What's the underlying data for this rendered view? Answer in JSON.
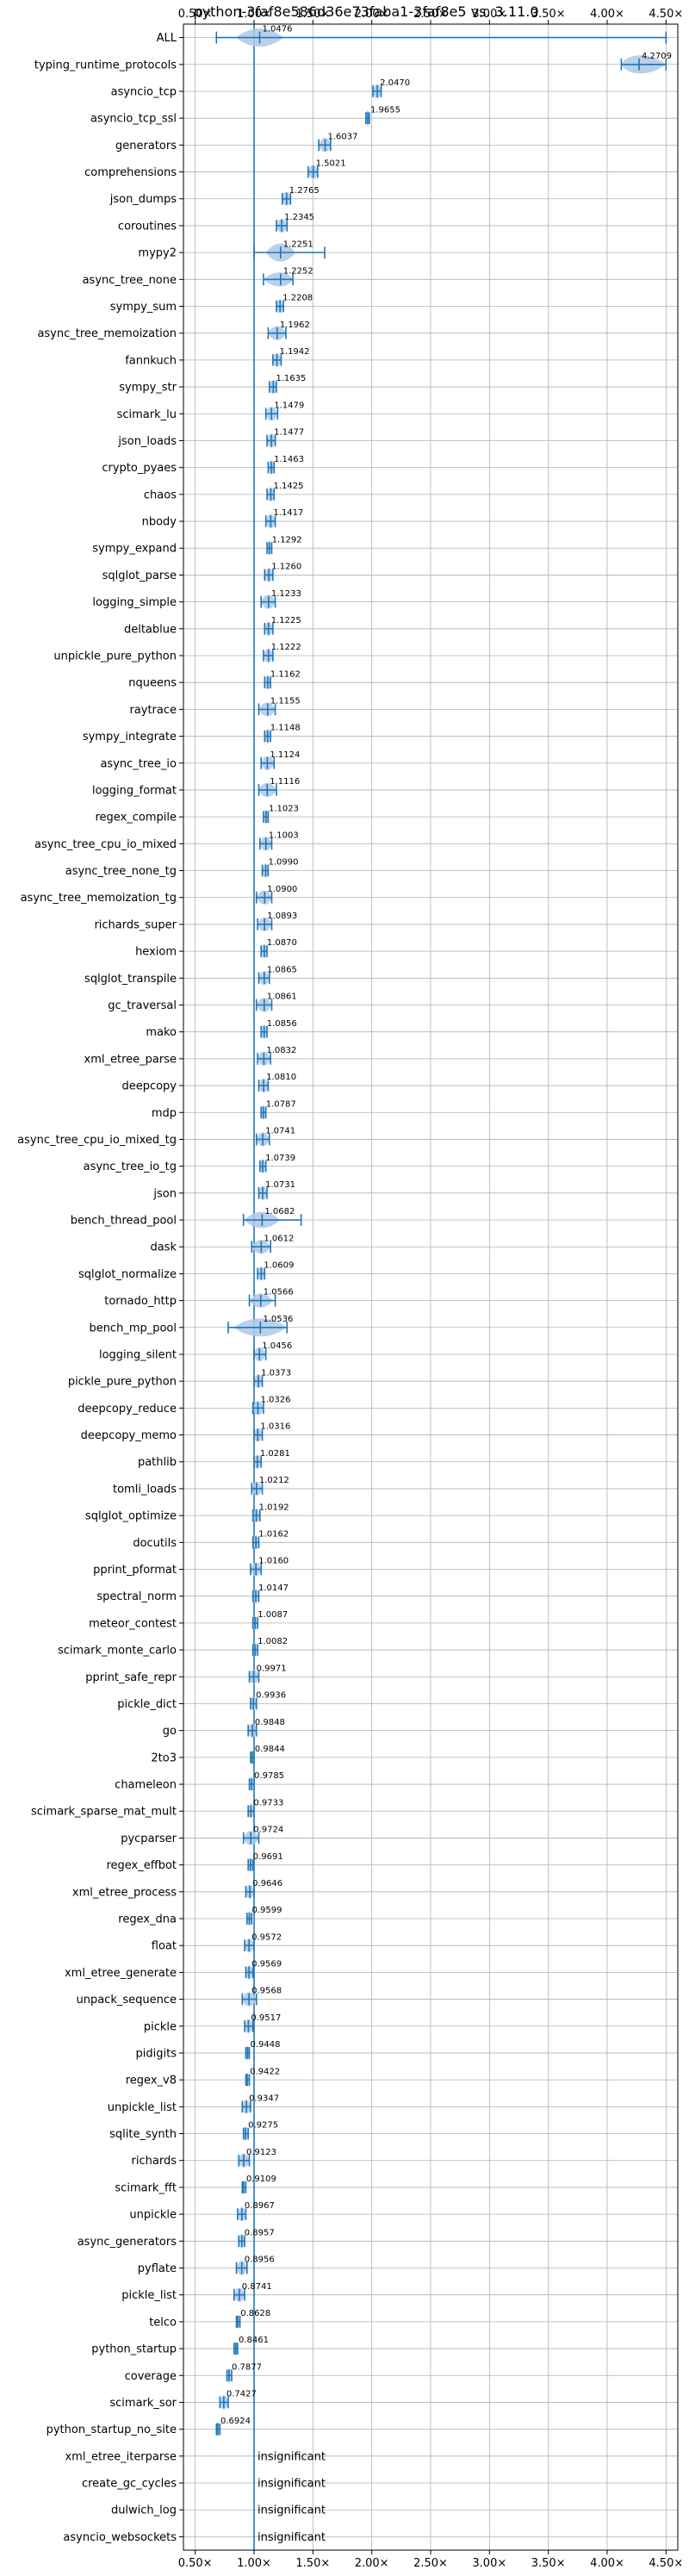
{
  "chart_data": {
    "type": "violin",
    "title": "python-3faf8e586d36e73faba1-3faf8e5 vs. 3.11.0",
    "xlim": [
      0.4,
      4.6
    ],
    "x_ticks": [
      0.5,
      1.0,
      1.5,
      2.0,
      2.5,
      3.0,
      3.5,
      4.0,
      4.5
    ],
    "x_tick_labels": [
      "0.50×",
      "1.00×",
      "1.50×",
      "2.00×",
      "2.50×",
      "3.00×",
      "3.50×",
      "4.00×",
      "4.50×"
    ],
    "reference_line": 1.0,
    "grid": true,
    "accent_color": "#1f77b4",
    "violin_color": "#aec7e8",
    "insignificant_text": "insignificant",
    "rows": [
      {
        "label": "ALL",
        "value": 1.0476,
        "value_label": "1.0476",
        "min": 0.68,
        "max": 4.5,
        "spread": 0.08,
        "height": 0.45
      },
      {
        "label": "typing_runtime_protocols",
        "value": 4.2709,
        "value_label": "4.2709",
        "min": 4.12,
        "max": 4.5,
        "spread": 0.1,
        "height": 0.45
      },
      {
        "label": "asyncio_tcp",
        "value": 2.047,
        "value_label": "2.0470",
        "min": 2.01,
        "max": 2.08,
        "spread": 0.03,
        "height": 0.35
      },
      {
        "label": "asyncio_tcp_ssl",
        "value": 1.9655,
        "value_label": "1.9655",
        "min": 1.95,
        "max": 1.98,
        "spread": 0.01,
        "height": 0.4
      },
      {
        "label": "generators",
        "value": 1.6037,
        "value_label": "1.6037",
        "min": 1.55,
        "max": 1.65,
        "spread": 0.03,
        "height": 0.35
      },
      {
        "label": "comprehensions",
        "value": 1.5021,
        "value_label": "1.5021",
        "min": 1.46,
        "max": 1.54,
        "spread": 0.03,
        "height": 0.35
      },
      {
        "label": "json_dumps",
        "value": 1.2765,
        "value_label": "1.2765",
        "min": 1.24,
        "max": 1.31,
        "spread": 0.03,
        "height": 0.35
      },
      {
        "label": "coroutines",
        "value": 1.2345,
        "value_label": "1.2345",
        "min": 1.19,
        "max": 1.28,
        "spread": 0.03,
        "height": 0.35
      },
      {
        "label": "mypy2",
        "value": 1.2251,
        "value_label": "1.2251",
        "min": 1.0,
        "max": 1.6,
        "spread": 0.05,
        "height": 0.45
      },
      {
        "label": "async_tree_none",
        "value": 1.2252,
        "value_label": "1.2252",
        "min": 1.08,
        "max": 1.33,
        "spread": 0.06,
        "height": 0.35
      },
      {
        "label": "sympy_sum",
        "value": 1.2208,
        "value_label": "1.2208",
        "min": 1.19,
        "max": 1.25,
        "spread": 0.025,
        "height": 0.35
      },
      {
        "label": "async_tree_memoization",
        "value": 1.1962,
        "value_label": "1.1962",
        "min": 1.12,
        "max": 1.27,
        "spread": 0.04,
        "height": 0.35
      },
      {
        "label": "fannkuch",
        "value": 1.1942,
        "value_label": "1.1942",
        "min": 1.16,
        "max": 1.23,
        "spread": 0.025,
        "height": 0.35
      },
      {
        "label": "sympy_str",
        "value": 1.1635,
        "value_label": "1.1635",
        "min": 1.13,
        "max": 1.19,
        "spread": 0.025,
        "height": 0.35
      },
      {
        "label": "scimark_lu",
        "value": 1.1479,
        "value_label": "1.1479",
        "min": 1.1,
        "max": 1.2,
        "spread": 0.03,
        "height": 0.35
      },
      {
        "label": "json_loads",
        "value": 1.1477,
        "value_label": "1.1477",
        "min": 1.11,
        "max": 1.18,
        "spread": 0.025,
        "height": 0.35
      },
      {
        "label": "crypto_pyaes",
        "value": 1.1463,
        "value_label": "1.1463",
        "min": 1.12,
        "max": 1.17,
        "spread": 0.02,
        "height": 0.35
      },
      {
        "label": "chaos",
        "value": 1.1425,
        "value_label": "1.1425",
        "min": 1.11,
        "max": 1.17,
        "spread": 0.025,
        "height": 0.35
      },
      {
        "label": "nbody",
        "value": 1.1417,
        "value_label": "1.1417",
        "min": 1.1,
        "max": 1.18,
        "spread": 0.025,
        "height": 0.35
      },
      {
        "label": "sympy_expand",
        "value": 1.1292,
        "value_label": "1.1292",
        "min": 1.11,
        "max": 1.15,
        "spread": 0.02,
        "height": 0.35
      },
      {
        "label": "sqlglot_parse",
        "value": 1.126,
        "value_label": "1.1260",
        "min": 1.09,
        "max": 1.16,
        "spread": 0.025,
        "height": 0.35
      },
      {
        "label": "logging_simple",
        "value": 1.1233,
        "value_label": "1.1233",
        "min": 1.06,
        "max": 1.18,
        "spread": 0.035,
        "height": 0.35
      },
      {
        "label": "deltablue",
        "value": 1.1225,
        "value_label": "1.1225",
        "min": 1.09,
        "max": 1.16,
        "spread": 0.025,
        "height": 0.35
      },
      {
        "label": "unpickle_pure_python",
        "value": 1.1222,
        "value_label": "1.1222",
        "min": 1.08,
        "max": 1.16,
        "spread": 0.025,
        "height": 0.35
      },
      {
        "label": "nqueens",
        "value": 1.1162,
        "value_label": "1.1162",
        "min": 1.09,
        "max": 1.14,
        "spread": 0.02,
        "height": 0.35
      },
      {
        "label": "raytrace",
        "value": 1.1155,
        "value_label": "1.1155",
        "min": 1.04,
        "max": 1.18,
        "spread": 0.035,
        "height": 0.35
      },
      {
        "label": "sympy_integrate",
        "value": 1.1148,
        "value_label": "1.1148",
        "min": 1.09,
        "max": 1.14,
        "spread": 0.02,
        "height": 0.35
      },
      {
        "label": "async_tree_io",
        "value": 1.1124,
        "value_label": "1.1124",
        "min": 1.06,
        "max": 1.17,
        "spread": 0.03,
        "height": 0.35
      },
      {
        "label": "logging_format",
        "value": 1.1116,
        "value_label": "1.1116",
        "min": 1.04,
        "max": 1.19,
        "spread": 0.035,
        "height": 0.35
      },
      {
        "label": "regex_compile",
        "value": 1.1023,
        "value_label": "1.1023",
        "min": 1.08,
        "max": 1.12,
        "spread": 0.02,
        "height": 0.35
      },
      {
        "label": "async_tree_cpu_io_mixed",
        "value": 1.1003,
        "value_label": "1.1003",
        "min": 1.05,
        "max": 1.15,
        "spread": 0.03,
        "height": 0.35
      },
      {
        "label": "async_tree_none_tg",
        "value": 1.099,
        "value_label": "1.0990",
        "min": 1.07,
        "max": 1.12,
        "spread": 0.02,
        "height": 0.35
      },
      {
        "label": "async_tree_memoization_tg",
        "value": 1.09,
        "value_label": "1.0900",
        "min": 1.02,
        "max": 1.15,
        "spread": 0.035,
        "height": 0.35
      },
      {
        "label": "richards_super",
        "value": 1.0893,
        "value_label": "1.0893",
        "min": 1.03,
        "max": 1.15,
        "spread": 0.035,
        "height": 0.35
      },
      {
        "label": "hexiom",
        "value": 1.087,
        "value_label": "1.0870",
        "min": 1.06,
        "max": 1.11,
        "spread": 0.02,
        "height": 0.35
      },
      {
        "label": "sqlglot_transpile",
        "value": 1.0865,
        "value_label": "1.0865",
        "min": 1.04,
        "max": 1.13,
        "spread": 0.03,
        "height": 0.35
      },
      {
        "label": "gc_traversal",
        "value": 1.0861,
        "value_label": "1.0861",
        "min": 1.02,
        "max": 1.15,
        "spread": 0.03,
        "height": 0.35
      },
      {
        "label": "mako",
        "value": 1.0856,
        "value_label": "1.0856",
        "min": 1.06,
        "max": 1.11,
        "spread": 0.02,
        "height": 0.35
      },
      {
        "label": "xml_etree_parse",
        "value": 1.0832,
        "value_label": "1.0832",
        "min": 1.03,
        "max": 1.14,
        "spread": 0.03,
        "height": 0.35
      },
      {
        "label": "deepcopy",
        "value": 1.081,
        "value_label": "1.0810",
        "min": 1.04,
        "max": 1.12,
        "spread": 0.025,
        "height": 0.35
      },
      {
        "label": "mdp",
        "value": 1.0787,
        "value_label": "1.0787",
        "min": 1.06,
        "max": 1.1,
        "spread": 0.02,
        "height": 0.35
      },
      {
        "label": "async_tree_cpu_io_mixed_tg",
        "value": 1.0741,
        "value_label": "1.0741",
        "min": 1.02,
        "max": 1.13,
        "spread": 0.03,
        "height": 0.35
      },
      {
        "label": "async_tree_io_tg",
        "value": 1.0739,
        "value_label": "1.0739",
        "min": 1.05,
        "max": 1.1,
        "spread": 0.02,
        "height": 0.35
      },
      {
        "label": "json",
        "value": 1.0731,
        "value_label": "1.0731",
        "min": 1.04,
        "max": 1.11,
        "spread": 0.025,
        "height": 0.35
      },
      {
        "label": "bench_thread_pool",
        "value": 1.0682,
        "value_label": "1.0682",
        "min": 0.91,
        "max": 1.4,
        "spread": 0.06,
        "height": 0.4
      },
      {
        "label": "dask",
        "value": 1.0612,
        "value_label": "1.0612",
        "min": 0.98,
        "max": 1.14,
        "spread": 0.035,
        "height": 0.35
      },
      {
        "label": "sqlglot_normalize",
        "value": 1.0609,
        "value_label": "1.0609",
        "min": 1.03,
        "max": 1.09,
        "spread": 0.025,
        "height": 0.35
      },
      {
        "label": "tornado_http",
        "value": 1.0566,
        "value_label": "1.0566",
        "min": 0.96,
        "max": 1.18,
        "spread": 0.04,
        "height": 0.35
      },
      {
        "label": "bench_mp_pool",
        "value": 1.0536,
        "value_label": "1.0536",
        "min": 0.78,
        "max": 1.28,
        "spread": 0.09,
        "height": 0.45
      },
      {
        "label": "logging_silent",
        "value": 1.0456,
        "value_label": "1.0456",
        "min": 1.0,
        "max": 1.1,
        "spread": 0.03,
        "height": 0.35
      },
      {
        "label": "pickle_pure_python",
        "value": 1.0373,
        "value_label": "1.0373",
        "min": 1.0,
        "max": 1.07,
        "spread": 0.025,
        "height": 0.35
      },
      {
        "label": "deepcopy_reduce",
        "value": 1.0326,
        "value_label": "1.0326",
        "min": 0.99,
        "max": 1.08,
        "spread": 0.03,
        "height": 0.35
      },
      {
        "label": "deepcopy_memo",
        "value": 1.0316,
        "value_label": "1.0316",
        "min": 1.0,
        "max": 1.07,
        "spread": 0.025,
        "height": 0.35
      },
      {
        "label": "pathlib",
        "value": 1.0281,
        "value_label": "1.0281",
        "min": 1.0,
        "max": 1.06,
        "spread": 0.025,
        "height": 0.35
      },
      {
        "label": "tomli_loads",
        "value": 1.0212,
        "value_label": "1.0212",
        "min": 0.98,
        "max": 1.07,
        "spread": 0.025,
        "height": 0.35
      },
      {
        "label": "sqlglot_optimize",
        "value": 1.0192,
        "value_label": "1.0192",
        "min": 0.99,
        "max": 1.05,
        "spread": 0.02,
        "height": 0.35
      },
      {
        "label": "docutils",
        "value": 1.0162,
        "value_label": "1.0162",
        "min": 0.99,
        "max": 1.04,
        "spread": 0.02,
        "height": 0.35
      },
      {
        "label": "pprint_pformat",
        "value": 1.016,
        "value_label": "1.0160",
        "min": 0.97,
        "max": 1.06,
        "spread": 0.025,
        "height": 0.35
      },
      {
        "label": "spectral_norm",
        "value": 1.0147,
        "value_label": "1.0147",
        "min": 0.99,
        "max": 1.04,
        "spread": 0.02,
        "height": 0.35
      },
      {
        "label": "meteor_contest",
        "value": 1.0087,
        "value_label": "1.0087",
        "min": 0.99,
        "max": 1.03,
        "spread": 0.015,
        "height": 0.35
      },
      {
        "label": "scimark_monte_carlo",
        "value": 1.0082,
        "value_label": "1.0082",
        "min": 0.99,
        "max": 1.03,
        "spread": 0.015,
        "height": 0.35
      },
      {
        "label": "pprint_safe_repr",
        "value": 0.9971,
        "value_label": "0.9971",
        "min": 0.96,
        "max": 1.04,
        "spread": 0.025,
        "height": 0.35
      },
      {
        "label": "pickle_dict",
        "value": 0.9936,
        "value_label": "0.9936",
        "min": 0.97,
        "max": 1.02,
        "spread": 0.02,
        "height": 0.35
      },
      {
        "label": "go",
        "value": 0.9848,
        "value_label": "0.9848",
        "min": 0.95,
        "max": 1.02,
        "spread": 0.025,
        "height": 0.35
      },
      {
        "label": "2to3",
        "value": 0.9844,
        "value_label": "0.9844",
        "min": 0.97,
        "max": 1.0,
        "spread": 0.015,
        "height": 0.35
      },
      {
        "label": "chameleon",
        "value": 0.9785,
        "value_label": "0.9785",
        "min": 0.96,
        "max": 1.0,
        "spread": 0.015,
        "height": 0.35
      },
      {
        "label": "scimark_sparse_mat_mult",
        "value": 0.9733,
        "value_label": "0.9733",
        "min": 0.95,
        "max": 1.0,
        "spread": 0.02,
        "height": 0.35
      },
      {
        "label": "pycparser",
        "value": 0.9724,
        "value_label": "0.9724",
        "min": 0.91,
        "max": 1.04,
        "spread": 0.035,
        "height": 0.35
      },
      {
        "label": "regex_effbot",
        "value": 0.9691,
        "value_label": "0.9691",
        "min": 0.95,
        "max": 0.99,
        "spread": 0.015,
        "height": 0.35
      },
      {
        "label": "xml_etree_process",
        "value": 0.9646,
        "value_label": "0.9646",
        "min": 0.93,
        "max": 1.0,
        "spread": 0.025,
        "height": 0.35
      },
      {
        "label": "regex_dna",
        "value": 0.9599,
        "value_label": "0.9599",
        "min": 0.94,
        "max": 0.98,
        "spread": 0.015,
        "height": 0.35
      },
      {
        "label": "float",
        "value": 0.9572,
        "value_label": "0.9572",
        "min": 0.92,
        "max": 1.0,
        "spread": 0.025,
        "height": 0.35
      },
      {
        "label": "xml_etree_generate",
        "value": 0.9569,
        "value_label": "0.9569",
        "min": 0.93,
        "max": 0.99,
        "spread": 0.02,
        "height": 0.35
      },
      {
        "label": "unpack_sequence",
        "value": 0.9568,
        "value_label": "0.9568",
        "min": 0.9,
        "max": 1.02,
        "spread": 0.035,
        "height": 0.35
      },
      {
        "label": "pickle",
        "value": 0.9517,
        "value_label": "0.9517",
        "min": 0.92,
        "max": 0.99,
        "spread": 0.025,
        "height": 0.35
      },
      {
        "label": "pidigits",
        "value": 0.9448,
        "value_label": "0.9448",
        "min": 0.93,
        "max": 0.96,
        "spread": 0.015,
        "height": 0.35
      },
      {
        "label": "regex_v8",
        "value": 0.9422,
        "value_label": "0.9422",
        "min": 0.93,
        "max": 0.96,
        "spread": 0.012,
        "height": 0.35
      },
      {
        "label": "unpickle_list",
        "value": 0.9347,
        "value_label": "0.9347",
        "min": 0.9,
        "max": 0.97,
        "spread": 0.025,
        "height": 0.35
      },
      {
        "label": "sqlite_synth",
        "value": 0.9275,
        "value_label": "0.9275",
        "min": 0.91,
        "max": 0.95,
        "spread": 0.015,
        "height": 0.35
      },
      {
        "label": "richards",
        "value": 0.9123,
        "value_label": "0.9123",
        "min": 0.87,
        "max": 0.96,
        "spread": 0.03,
        "height": 0.35
      },
      {
        "label": "scimark_fft",
        "value": 0.9109,
        "value_label": "0.9109",
        "min": 0.9,
        "max": 0.93,
        "spread": 0.012,
        "height": 0.35
      },
      {
        "label": "unpickle",
        "value": 0.8967,
        "value_label": "0.8967",
        "min": 0.86,
        "max": 0.93,
        "spread": 0.025,
        "height": 0.35
      },
      {
        "label": "async_generators",
        "value": 0.8957,
        "value_label": "0.8957",
        "min": 0.87,
        "max": 0.92,
        "spread": 0.02,
        "height": 0.35
      },
      {
        "label": "pyflate",
        "value": 0.8956,
        "value_label": "0.8956",
        "min": 0.85,
        "max": 0.94,
        "spread": 0.03,
        "height": 0.35
      },
      {
        "label": "pickle_list",
        "value": 0.8741,
        "value_label": "0.8741",
        "min": 0.83,
        "max": 0.92,
        "spread": 0.03,
        "height": 0.35
      },
      {
        "label": "telco",
        "value": 0.8628,
        "value_label": "0.8628",
        "min": 0.85,
        "max": 0.88,
        "spread": 0.012,
        "height": 0.35
      },
      {
        "label": "python_startup",
        "value": 0.8461,
        "value_label": "0.8461",
        "min": 0.83,
        "max": 0.86,
        "spread": 0.012,
        "height": 0.35
      },
      {
        "label": "coverage",
        "value": 0.7877,
        "value_label": "0.7877",
        "min": 0.77,
        "max": 0.81,
        "spread": 0.015,
        "height": 0.35
      },
      {
        "label": "scimark_sor",
        "value": 0.7427,
        "value_label": "0.7427",
        "min": 0.71,
        "max": 0.78,
        "spread": 0.025,
        "height": 0.35
      },
      {
        "label": "python_startup_no_site",
        "value": 0.6924,
        "value_label": "0.6924",
        "min": 0.68,
        "max": 0.71,
        "spread": 0.01,
        "height": 0.35
      },
      {
        "label": "xml_etree_iterparse",
        "insignificant": true
      },
      {
        "label": "create_gc_cycles",
        "insignificant": true
      },
      {
        "label": "dulwich_log",
        "insignificant": true
      },
      {
        "label": "asyncio_websockets",
        "insignificant": true
      }
    ]
  }
}
